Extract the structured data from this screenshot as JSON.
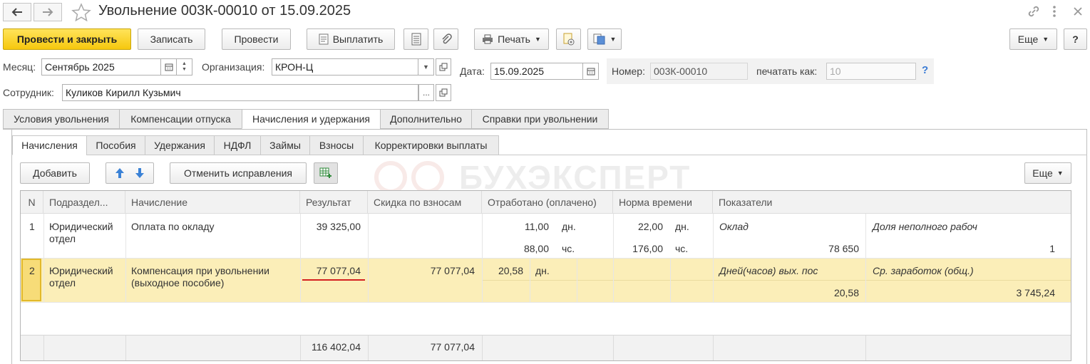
{
  "window": {
    "title": "Увольнение 003К-00010 от 15.09.2025"
  },
  "toolbar": {
    "post_close": "Провести и закрыть",
    "save": "Записать",
    "post": "Провести",
    "pay": "Выплатить",
    "print": "Печать",
    "more": "Еще",
    "help": "?"
  },
  "header": {
    "month_label": "Месяц:",
    "month_value": "Сентябрь 2025",
    "org_label": "Организация:",
    "org_value": "КРОН-Ц",
    "date_label": "Дата:",
    "date_value": "15.09.2025",
    "number_label": "Номер:",
    "number_value": "003К-00010",
    "print_as_label": "печатать как:",
    "print_as_placeholder": "10",
    "help_mark": "?",
    "employee_label": "Сотрудник:",
    "employee_value": "Куликов Кирилл Кузьмич"
  },
  "tabs": [
    "Условия увольнения",
    "Компенсации отпуска",
    "Начисления и удержания",
    "Дополнительно",
    "Справки при увольнении"
  ],
  "subtabs": [
    "Начисления",
    "Пособия",
    "Удержания",
    "НДФЛ",
    "Займы",
    "Взносы",
    "Корректировки выплаты"
  ],
  "table_toolbar": {
    "add": "Добавить",
    "cancel_fixes": "Отменить исправления",
    "more": "Еще"
  },
  "watermark": "БУХЭКСПЕРТ",
  "table": {
    "columns": [
      "N",
      "Подраздел...",
      "Начисление",
      "Результат",
      "Скидка по взносам",
      "Отработано (оплачено)",
      "Норма времени",
      "Показатели"
    ],
    "rows": [
      {
        "n": "1",
        "dept_line1": "Юридический",
        "dept_line2": "отдел",
        "accrual_line1": "Оплата по окладу",
        "accrual_line2": "",
        "result": "39 325,00",
        "discount": "",
        "worked1": "11,00",
        "worked_unit1": "дн.",
        "worked2": "88,00",
        "worked_unit2": "чс.",
        "norm1": "22,00",
        "norm_unit1": "дн.",
        "norm2": "176,00",
        "norm_unit2": "чс.",
        "ind1_name": "Оклад",
        "ind1_value": "78 650",
        "ind2_name": "Доля неполного рабоч",
        "ind2_value": "1"
      },
      {
        "n": "2",
        "dept_line1": "Юридический",
        "dept_line2": "отдел",
        "accrual_line1": "Компенсация при увольнении",
        "accrual_line2": "(выходное пособие)",
        "result": "77 077,04",
        "discount": "77 077,04",
        "worked1": "20,58",
        "worked_unit1": "дн.",
        "ind1_name": "Дней(часов) вых. пос",
        "ind1_value": "20,58",
        "ind2_name": "Ср. заработок (общ.)",
        "ind2_value": "3 745,24"
      }
    ],
    "totals": {
      "result": "116 402,04",
      "discount": "77 077,04"
    }
  }
}
